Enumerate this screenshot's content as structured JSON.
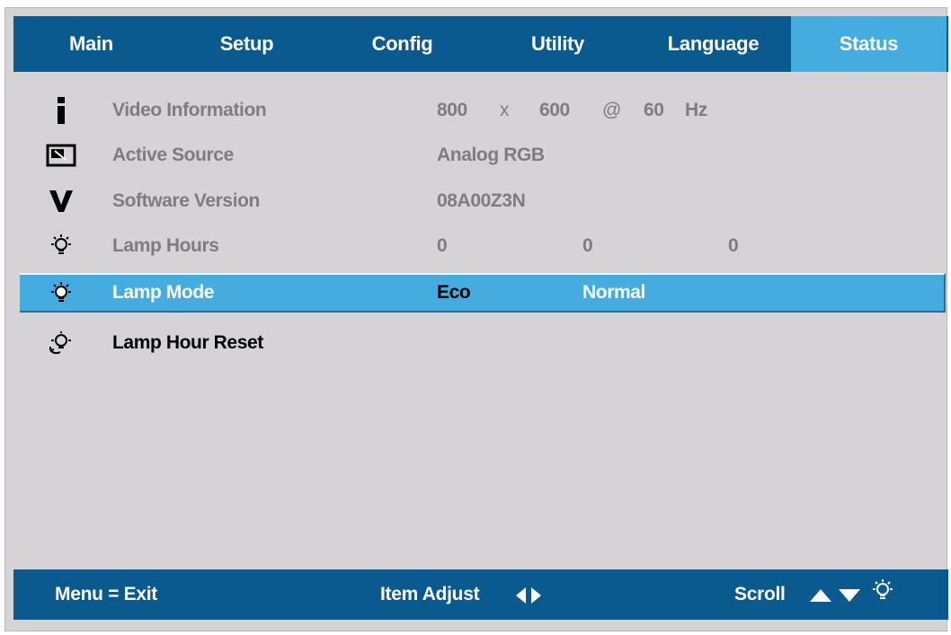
{
  "tabs": [
    {
      "label": "Main"
    },
    {
      "label": "Setup"
    },
    {
      "label": "Config"
    },
    {
      "label": "Utility"
    },
    {
      "label": "Language"
    },
    {
      "label": "Status"
    }
  ],
  "active_tab": "Status",
  "rows": {
    "video_info": {
      "label": "Video Information",
      "width": "800",
      "x": "x",
      "height": "600",
      "at": "@",
      "rate": "60",
      "unit": "Hz",
      "icon": "info-icon"
    },
    "active_source": {
      "label": "Active Source",
      "value": "Analog RGB",
      "icon": "source-icon"
    },
    "software_version": {
      "label": "Software Version",
      "value": "08A00Z3N",
      "icon": "version-icon"
    },
    "lamp_hours": {
      "label": "Lamp Hours",
      "v1": "0",
      "v2": "0",
      "v3": "0",
      "icon": "lamp-icon"
    },
    "lamp_mode": {
      "label": "Lamp Mode",
      "opt1": "Eco",
      "opt2": "Normal",
      "icon": "lamp-icon"
    },
    "lamp_hour_reset": {
      "label": "Lamp Hour Reset",
      "icon": "lamp-reset-icon"
    }
  },
  "footer": {
    "exit": "Menu = Exit",
    "adjust": "Item Adjust",
    "scroll": "Scroll"
  },
  "colors": {
    "bar": "#0a5a8f",
    "highlight": "#44acdf",
    "background": "#d6d3d6",
    "disabled_text": "#7d7d7d"
  }
}
